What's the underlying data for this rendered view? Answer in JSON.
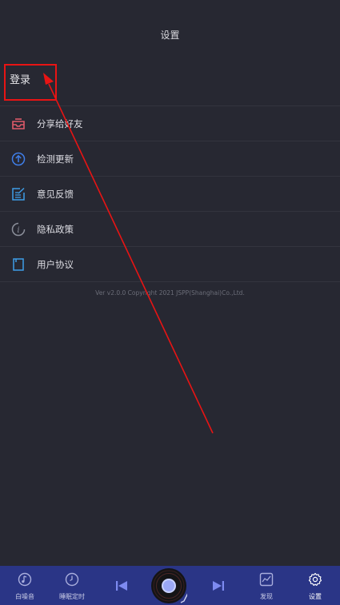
{
  "header": {
    "title": "设置"
  },
  "login": {
    "label": "登录"
  },
  "menu": [
    {
      "label": "分享给好友",
      "icon": "share-tray-icon",
      "color": "#e05a6a"
    },
    {
      "label": "检测更新",
      "icon": "upload-circle-icon",
      "color": "#3f7ee8"
    },
    {
      "label": "意见反馈",
      "icon": "edit-note-icon",
      "color": "#3f9ee8"
    },
    {
      "label": "隐私政策",
      "icon": "info-circle-icon",
      "color": "#8b8f9a"
    },
    {
      "label": "用户协议",
      "icon": "document-icon",
      "color": "#3f9ee8"
    }
  ],
  "version": "Ver v2.0.0 Copyright 2021 JSPP(Shanghai)Co.,Ltd.",
  "bottom_nav": {
    "tabs": [
      {
        "label": "白噪音",
        "icon": "music-note-circle-icon"
      },
      {
        "label": "睡眠定时",
        "icon": "clock-icon"
      },
      {
        "label": "发现",
        "icon": "chart-frame-icon"
      },
      {
        "label": "设置",
        "icon": "gear-icon",
        "active": true
      }
    ],
    "controls": [
      "previous-track-icon",
      "vinyl-disc-icon",
      "next-track-icon"
    ]
  },
  "colors": {
    "background": "#272832",
    "nav_bar": "#2a3586",
    "annotation": "#e81414"
  }
}
